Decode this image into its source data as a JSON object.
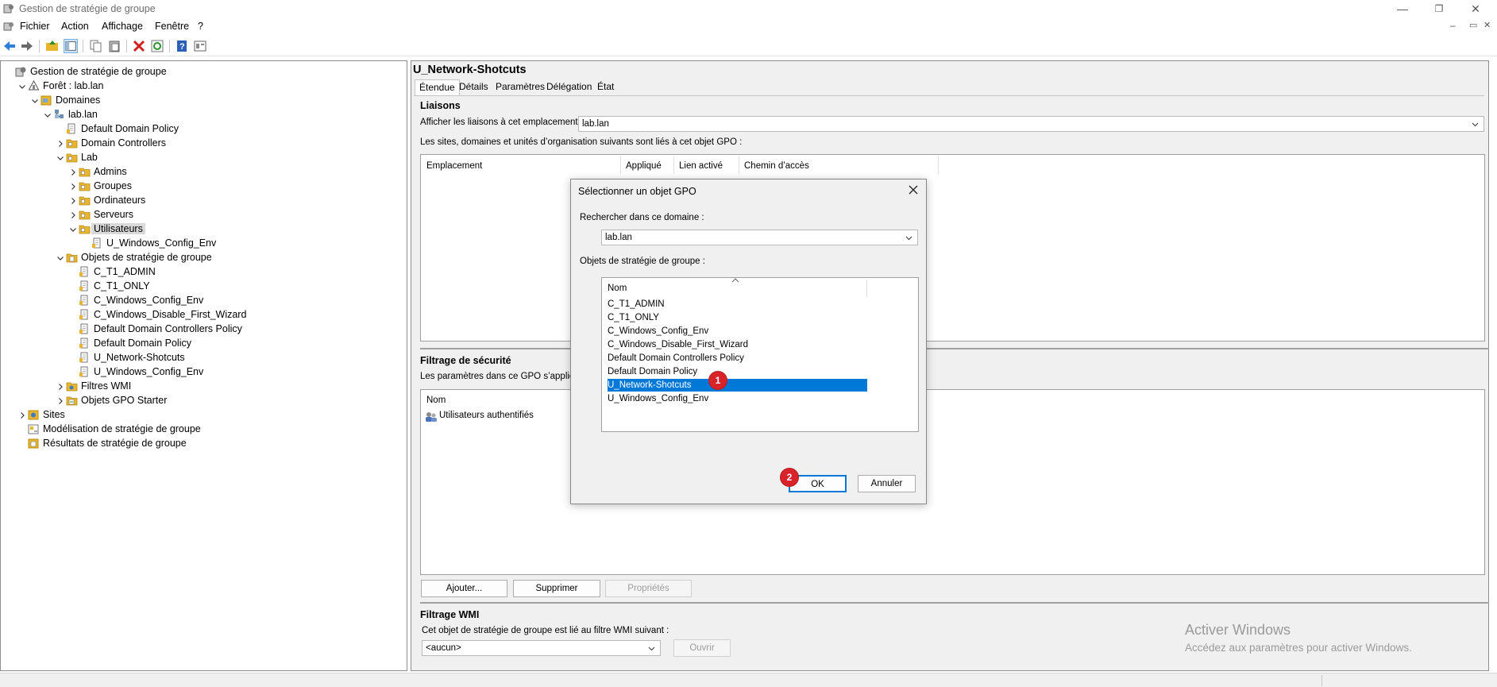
{
  "window": {
    "title": "Gestion de stratégie de groupe",
    "minimize": "—",
    "restore": "❐",
    "close": "✕",
    "inner_minimize": "–",
    "inner_restore": "▭",
    "inner_close": "✕"
  },
  "menu": [
    "Fichier",
    "Action",
    "Affichage",
    "Fenêtre",
    "?"
  ],
  "toolbar_icons": [
    "back-icon",
    "forward-icon",
    "up-folder-icon",
    "console-tree-icon",
    "copy-icon",
    "paste-icon",
    "delete-icon",
    "refresh-icon",
    "help-icon",
    "properties-icon"
  ],
  "tree": [
    {
      "label": "Gestion de stratégie de groupe",
      "level": 0,
      "icon": "gpm-icon",
      "chev": "none"
    },
    {
      "label": "Forêt : lab.lan",
      "level": 1,
      "icon": "forest-icon",
      "chev": "down"
    },
    {
      "label": "Domaines",
      "level": 2,
      "icon": "domains-icon",
      "chev": "down"
    },
    {
      "label": "lab.lan",
      "level": 3,
      "icon": "domain-icon",
      "chev": "down"
    },
    {
      "label": "Default Domain Policy",
      "level": 4,
      "icon": "gpo-link-icon",
      "chev": "none"
    },
    {
      "label": "Domain Controllers",
      "level": 4,
      "icon": "ou-folder-icon",
      "chev": "right"
    },
    {
      "label": "Lab",
      "level": 4,
      "icon": "ou-folder-icon",
      "chev": "down"
    },
    {
      "label": "Admins",
      "level": 5,
      "icon": "ou-folder-icon",
      "chev": "right"
    },
    {
      "label": "Groupes",
      "level": 5,
      "icon": "ou-folder-icon",
      "chev": "right"
    },
    {
      "label": "Ordinateurs",
      "level": 5,
      "icon": "ou-folder-icon",
      "chev": "right"
    },
    {
      "label": "Serveurs",
      "level": 5,
      "icon": "ou-folder-icon",
      "chev": "right"
    },
    {
      "label": "Utilisateurs",
      "level": 5,
      "icon": "ou-folder-icon",
      "chev": "down",
      "selected": true
    },
    {
      "label": "U_Windows_Config_Env",
      "level": 6,
      "icon": "gpo-link-icon",
      "chev": "none"
    },
    {
      "label": "Objets de stratégie de groupe",
      "level": 4,
      "icon": "gpo-container-icon",
      "chev": "down"
    },
    {
      "label": "C_T1_ADMIN",
      "level": 5,
      "icon": "gpo-icon",
      "chev": "none"
    },
    {
      "label": "C_T1_ONLY",
      "level": 5,
      "icon": "gpo-icon",
      "chev": "none"
    },
    {
      "label": "C_Windows_Config_Env",
      "level": 5,
      "icon": "gpo-icon",
      "chev": "none"
    },
    {
      "label": "C_Windows_Disable_First_Wizard",
      "level": 5,
      "icon": "gpo-icon",
      "chev": "none"
    },
    {
      "label": "Default Domain Controllers Policy",
      "level": 5,
      "icon": "gpo-icon",
      "chev": "none"
    },
    {
      "label": "Default Domain Policy",
      "level": 5,
      "icon": "gpo-icon",
      "chev": "none"
    },
    {
      "label": "U_Network-Shotcuts",
      "level": 5,
      "icon": "gpo-icon",
      "chev": "none"
    },
    {
      "label": "U_Windows_Config_Env",
      "level": 5,
      "icon": "gpo-icon",
      "chev": "none"
    },
    {
      "label": "Filtres WMI",
      "level": 4,
      "icon": "wmi-folder-icon",
      "chev": "right"
    },
    {
      "label": "Objets GPO Starter",
      "level": 4,
      "icon": "starter-gpo-icon",
      "chev": "right"
    },
    {
      "label": "Sites",
      "level": 1,
      "icon": "sites-icon",
      "chev": "right"
    },
    {
      "label": "Modélisation de stratégie de groupe",
      "level": 1,
      "icon": "modeling-icon",
      "chev": "none"
    },
    {
      "label": "Résultats de stratégie de groupe",
      "level": 1,
      "icon": "results-icon",
      "chev": "none"
    }
  ],
  "detail": {
    "gpo_title": "U_Network-Shotcuts",
    "tabs": [
      "Étendue",
      "Détails",
      "Paramètres",
      "Délégation",
      "État"
    ],
    "active_tab": "Étendue",
    "links": {
      "heading": "Liaisons",
      "show_links_label": "Afficher les liaisons à cet emplacement :",
      "show_links_value": "lab.lan",
      "description": "Les sites, domaines et unités d’organisation suivants sont liés à cet objet GPO :",
      "columns": [
        "Emplacement",
        "Appliqué",
        "Lien activé",
        "Chemin d’accès"
      ]
    },
    "security": {
      "heading": "Filtrage de sécurité",
      "description": "Les paramètres dans ce GPO s’applique",
      "column": "Nom",
      "row": "Utilisateurs authentifiés",
      "buttons": {
        "add": "Ajouter...",
        "remove": "Supprimer",
        "properties": "Propriétés"
      }
    },
    "wmi": {
      "heading": "Filtrage WMI",
      "description": "Cet objet de stratégie de groupe est lié au filtre WMI suivant :",
      "value": "<aucun>",
      "open": "Ouvrir"
    }
  },
  "dialog": {
    "title": "Sélectionner un objet GPO",
    "search_label": "Rechercher dans ce domaine :",
    "search_value": "lab.lan",
    "list_label": "Objets de stratégie de groupe :",
    "column": "Nom",
    "items": [
      "C_T1_ADMIN",
      "C_T1_ONLY",
      "C_Windows_Config_Env",
      "C_Windows_Disable_First_Wizard",
      "Default Domain Controllers Policy",
      "Default Domain Policy",
      "U_Network-Shotcuts",
      "U_Windows_Config_Env"
    ],
    "selected": "U_Network-Shotcuts",
    "ok": "OK",
    "cancel": "Annuler"
  },
  "badges": {
    "one": "1",
    "two": "2"
  },
  "watermark": {
    "line1": "Activer Windows",
    "line2": "Accédez aux paramètres pour activer Windows."
  },
  "colors": {
    "selection": "#0078d7",
    "badge": "#d8232a",
    "folder": "#e8b62e"
  }
}
